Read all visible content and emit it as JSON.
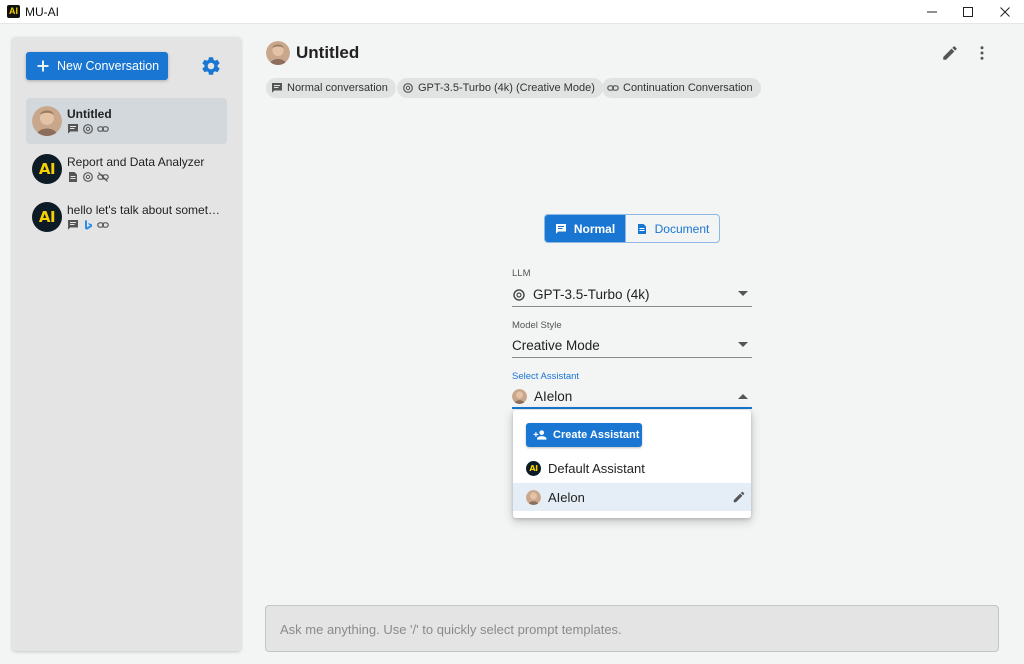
{
  "window": {
    "title": "MU-AI",
    "app_icon_text": "AI"
  },
  "sidebar": {
    "new_conversation_label": "New Conversation",
    "conversations": [
      {
        "title": "Untitled",
        "active": true
      },
      {
        "title": "Report and Data Analyzer",
        "active": false
      },
      {
        "title": "hello let's talk about something",
        "active": false
      }
    ]
  },
  "header": {
    "title": "Untitled",
    "chips": [
      {
        "label": "Normal conversation",
        "icon": "chat-icon"
      },
      {
        "label": "GPT-3.5-Turbo (4k) (Creative Mode)",
        "icon": "openai-icon"
      },
      {
        "label": "Continuation Conversation",
        "icon": "link-icon"
      }
    ]
  },
  "mode_toggle": {
    "normal_label": "Normal",
    "document_label": "Document",
    "selected": "Normal"
  },
  "form": {
    "llm": {
      "label": "LLM",
      "value": "GPT-3.5-Turbo (4k)"
    },
    "model_style": {
      "label": "Model Style",
      "value": "Creative Mode"
    },
    "assistant": {
      "label": "Select Assistant",
      "value": "AIelon"
    }
  },
  "assistant_menu": {
    "create_label": "Create Assistant",
    "items": [
      {
        "label": "Default Assistant",
        "selected": false
      },
      {
        "label": "AIelon",
        "selected": true
      }
    ]
  },
  "prompt": {
    "placeholder": "Ask me anything. Use '/' to quickly select prompt templates."
  },
  "colors": {
    "accent": "#1976d2",
    "sidebar_bg": "#e4e4e4",
    "page_bg": "#f3f4f4",
    "ai_logo_yellow": "#f6d000",
    "ai_logo_dark": "#0d1b26"
  }
}
